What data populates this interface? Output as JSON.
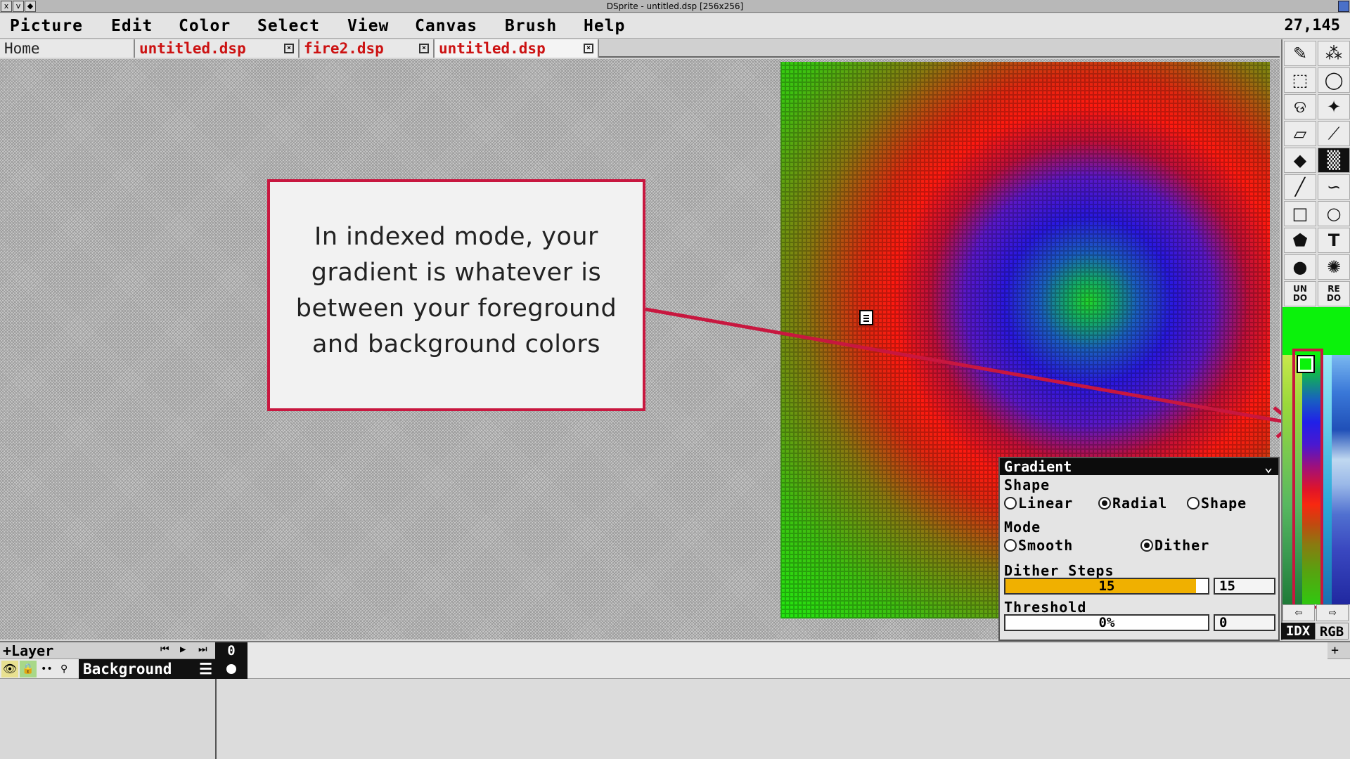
{
  "window": {
    "title": "DSprite - untitled.dsp [256x256]",
    "controls": [
      "x",
      "v",
      "◆"
    ]
  },
  "menu": {
    "items": [
      "Picture",
      "Edit",
      "Color",
      "Select",
      "View",
      "Canvas",
      "Brush",
      "Help"
    ],
    "coords": "27,145"
  },
  "tabs": {
    "home": "Home",
    "items": [
      "untitled.dsp",
      "fire2.dsp",
      "untitled.dsp"
    ],
    "close_glyph": "⊠"
  },
  "callout": {
    "lines": [
      "In indexed mode, your",
      "gradient is whatever is",
      "between your foreground",
      "and background colors"
    ],
    "border_color": "#c8173f"
  },
  "tools": {
    "icons": [
      "pencil-icon",
      "spray-icon",
      "rect-select-icon",
      "ellipse-select-icon",
      "lasso-icon",
      "magic-wand-icon",
      "eraser-icon",
      "eyedropper-icon",
      "fill-icon",
      "gradient-icon",
      "line-icon",
      "curve-icon",
      "rectangle-icon",
      "ellipse-icon",
      "polygon-fill-icon",
      "text-icon",
      "brush-dot-icon",
      "sparkle-icon"
    ],
    "undo": "UN\nDO",
    "redo": "RE\nDO",
    "idx": "IDX",
    "rgb": "RGB",
    "foreground_color": "#0bf20b"
  },
  "gradient": {
    "title": "Gradient",
    "shape_label": "Shape",
    "shape_options": [
      "Linear",
      "Radial",
      "Shape"
    ],
    "shape_selected": "Radial",
    "mode_label": "Mode",
    "mode_options": [
      "Smooth",
      "Dither"
    ],
    "mode_selected": "Dither",
    "dither_label": "Dither Steps",
    "dither_value": "15",
    "dither_field": "15",
    "dither_fraction": 0.94,
    "threshold_label": "Threshold",
    "threshold_value": "0%",
    "threshold_field": "0",
    "threshold_fraction": 0
  },
  "timeline": {
    "add_layer": "+Layer",
    "frame_number": "0",
    "layer_name": "Background",
    "add_frame": "+"
  }
}
